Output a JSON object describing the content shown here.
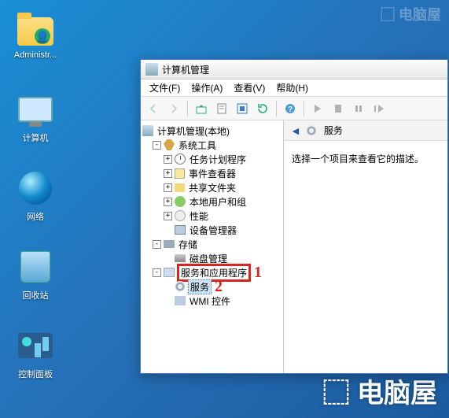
{
  "desktop_icons": [
    {
      "label": "Administr..."
    },
    {
      "label": "计算机"
    },
    {
      "label": "网络"
    },
    {
      "label": "回收站"
    },
    {
      "label": "控制面板"
    }
  ],
  "window": {
    "title": "计算机管理",
    "menu": [
      "文件(F)",
      "操作(A)",
      "查看(V)",
      "帮助(H)"
    ]
  },
  "tree": {
    "root": "计算机管理(本地)",
    "systools": "系统工具",
    "task": "任务计划程序",
    "event": "事件查看器",
    "share": "共享文件夹",
    "users": "本地用户和组",
    "perf": "性能",
    "dev": "设备管理器",
    "storage": "存储",
    "disk": "磁盘管理",
    "apps": "服务和应用程序",
    "svc": "服务",
    "wmi": "WMI 控件"
  },
  "annotations": {
    "one": "1",
    "two": "2"
  },
  "pane": {
    "header": "服务",
    "body": "选择一个项目来查看它的描述。"
  },
  "watermark": "电脑屋"
}
